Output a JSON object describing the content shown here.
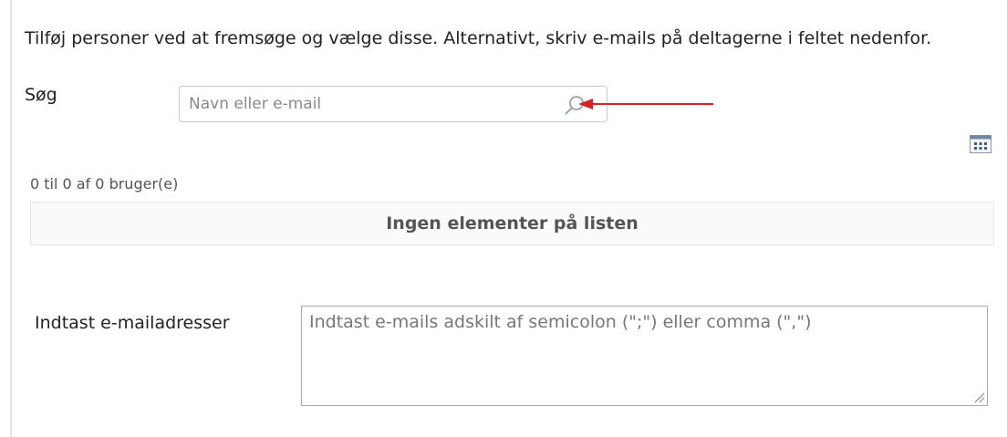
{
  "instructions": "Tilføj personer ved at fremsøge og vælge disse. Alternativt, skriv e-mails på deltagerne i feltet nedenfor.",
  "search": {
    "label": "Søg",
    "placeholder": "Navn eller e-mail",
    "icon": "magnifier-icon"
  },
  "toolbar": {
    "grid_icon": "grid-view-icon"
  },
  "results": {
    "count_text": "0 til 0 af 0 bruger(e)",
    "empty_text": "Ingen elementer på listen"
  },
  "email": {
    "label": "Indtast e-mailadresser",
    "placeholder": "Indtast e-mails adskilt af semicolon (\";\") eller comma (\",\")"
  },
  "colors": {
    "arrow": "#e02020",
    "border": "#c8c8c8",
    "grid_icon": "#4a6a9a"
  }
}
